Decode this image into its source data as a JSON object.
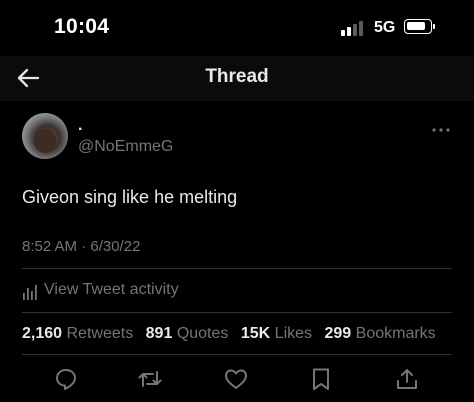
{
  "status_bar": {
    "time": "10:04",
    "network": "5G"
  },
  "nav": {
    "title": "Thread",
    "back_icon": "arrow-left-icon"
  },
  "tweet": {
    "display_name": ".",
    "handle": "@NoEmmeG",
    "text": "Giveon sing like he melting",
    "timestamp": "8:52 AM · 6/30/22",
    "activity_label": "View Tweet activity"
  },
  "stats": {
    "retweets_count": "2,160",
    "retweets_label": "Retweets",
    "quotes_count": "891",
    "quotes_label": "Quotes",
    "likes_count": "15K",
    "likes_label": "Likes",
    "bookmarks_count": "299",
    "bookmarks_label": "Bookmarks"
  },
  "actions": [
    "reply-icon",
    "retweet-icon",
    "like-icon",
    "bookmark-icon",
    "share-icon"
  ],
  "colors": {
    "background": "#000000",
    "header_bg": "#0b0b0b",
    "text_primary": "#e7e9ea",
    "text_secondary": "#71767b",
    "divider": "#2f3336"
  }
}
